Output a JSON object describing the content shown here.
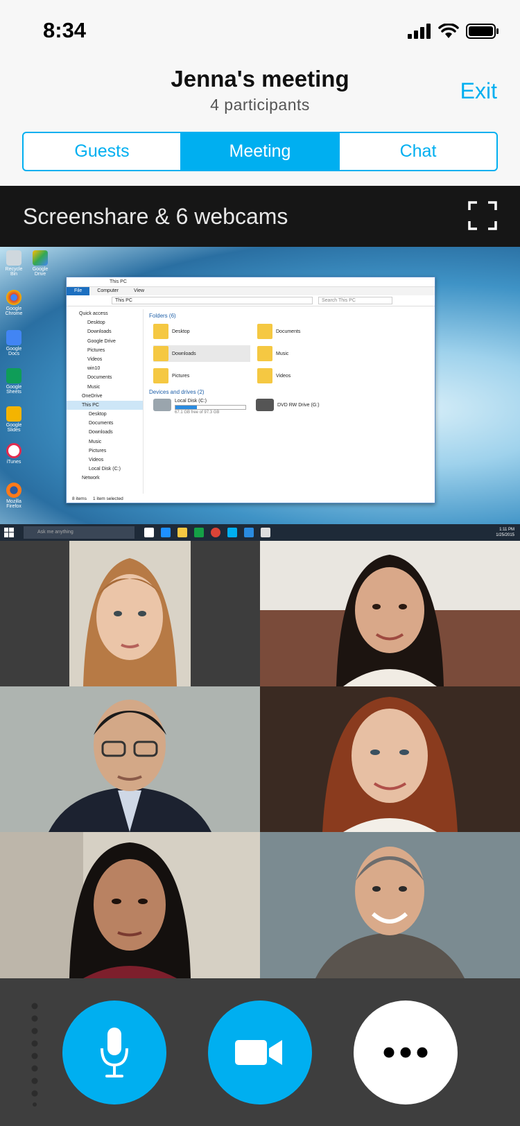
{
  "status": {
    "time": "8:34"
  },
  "header": {
    "title": "Jenna's meeting",
    "subtitle": "4 participants",
    "exit_label": "Exit"
  },
  "tabs": [
    {
      "label": "Guests",
      "active": false
    },
    {
      "label": "Meeting",
      "active": true
    },
    {
      "label": "Chat",
      "active": false
    }
  ],
  "share": {
    "title": "Screenshare & 6 webcams"
  },
  "desktop": {
    "icons": [
      "Recycle Bin",
      "Google Drive",
      "Google Chrome",
      "Google Docs",
      "Google Sheets",
      "Google Slides",
      "iTunes",
      "Mozilla Firefox"
    ],
    "explorer": {
      "window_title": "This PC",
      "menu": [
        "File",
        "Computer",
        "View"
      ],
      "address": "This PC",
      "search_placeholder": "Search This PC",
      "nav": [
        "Quick access",
        "Desktop",
        "Downloads",
        "Google Drive",
        "Pictures",
        "Videos",
        "win10",
        "Documents",
        "Music",
        "OneDrive",
        "This PC",
        "Desktop",
        "Documents",
        "Downloads",
        "Music",
        "Pictures",
        "Videos",
        "Local Disk (C:)",
        "Network"
      ],
      "folders_header": "Folders (6)",
      "folders": [
        "Desktop",
        "Documents",
        "Downloads",
        "Music",
        "Pictures",
        "Videos"
      ],
      "drives_header": "Devices and drives (2)",
      "drive_c_name": "Local Disk (C:)",
      "drive_c_free": "67.1 GB free of 97.3 GB",
      "drive_c_used_fraction": 0.31,
      "drive_g_name": "DVD RW Drive (G:)",
      "status_left": "8 items",
      "status_right": "1 item selected"
    },
    "taskbar": {
      "search_placeholder": "Ask me anything",
      "clock_time": "1:11 PM",
      "clock_date": "1/25/2015"
    }
  },
  "colors": {
    "accent": "#00aff0",
    "share_bar": "#161616",
    "controls_bg": "#3e3e3e"
  },
  "controls": {
    "mic": {
      "icon": "microphone-icon"
    },
    "video": {
      "icon": "video-camera-icon"
    },
    "more": {
      "icon": "more-icon"
    }
  }
}
